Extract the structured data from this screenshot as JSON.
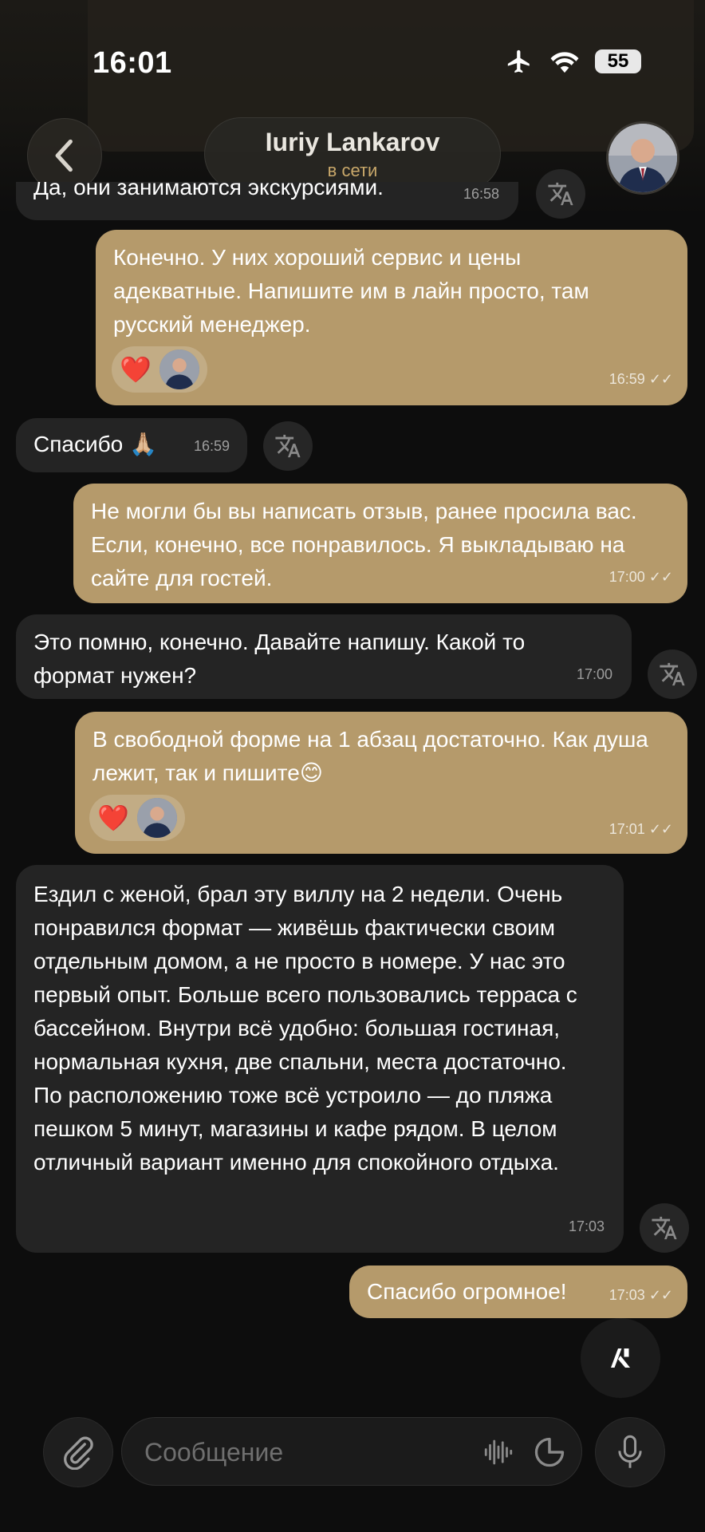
{
  "status_bar": {
    "time": "16:01",
    "battery": "55"
  },
  "header": {
    "contact_name": "Iuriy Lankarov",
    "contact_status": "в сети"
  },
  "messages": [
    {
      "dir": "in",
      "text": "Да, они занимаются экскурсиями.",
      "time": "16:58"
    },
    {
      "dir": "out",
      "text": "Конечно. У них хороший сервис и цены адекватные. Напишите им в лайн просто, там русский менеджер.",
      "time": "16:59",
      "reaction": "❤️"
    },
    {
      "dir": "in",
      "text": "Спасибо 🙏🏼",
      "time": "16:59"
    },
    {
      "dir": "out",
      "text": "Не могли бы вы написать отзыв, ранее просила вас. Если, конечно, все понравилось. Я выкладываю на сайте для гостей.",
      "time": "17:00"
    },
    {
      "dir": "in",
      "text": "Это помню, конечно. Давайте напишу. Какой то формат нужен?",
      "time": "17:00"
    },
    {
      "dir": "out",
      "text": "В свободной форме на 1 абзац достаточно. Как душа лежит, так и пишите😊",
      "time": "17:01",
      "reaction": "❤️"
    },
    {
      "dir": "in",
      "text": "Ездил с женой, брал эту виллу на 2 недели. Очень понравился формат — живёшь фактически своим отдельным домом, а не просто в номере. У нас это первый опыт. Больше всего пользовались терраса с бассейном. Внутри всё удобно: большая гостиная, нормальная кухня, две спальни, места достаточно. По расположению тоже всё устроило — до пляжа пешком 5 минут, магазины и кафе рядом. В целом отличный вариант именно для спокойного отдыха.",
      "time": "17:03"
    },
    {
      "dir": "out",
      "text": "Спасибо огромное!",
      "time": "17:03"
    }
  ],
  "input": {
    "placeholder": "Сообщение"
  },
  "colors": {
    "outgoing_bubble": "#b59a6b",
    "incoming_bubble": "#242424",
    "accent": "#c9a86a"
  },
  "icons": [
    "back-icon",
    "airplane-icon",
    "wifi-icon",
    "translate-icon",
    "read-checkmarks-icon",
    "heart-icon",
    "paperclip-icon",
    "waveform-icon",
    "sticker-icon",
    "microphone-icon",
    "ai-assistant-icon"
  ]
}
